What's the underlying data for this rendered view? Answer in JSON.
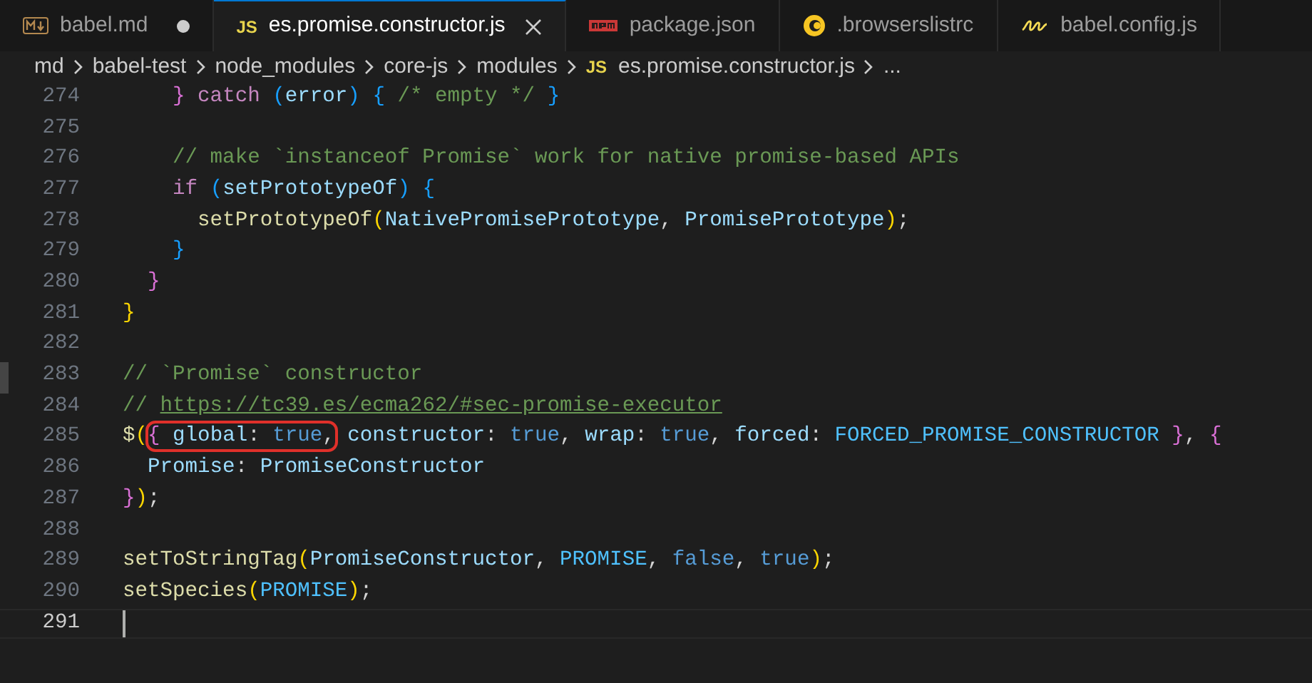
{
  "tabs": [
    {
      "label": "babel.md",
      "kind": "markdown",
      "dirty": true,
      "selected": false
    },
    {
      "label": "es.promise.constructor.js",
      "kind": "js",
      "icon_label": "JS",
      "dirty": false,
      "selected": true
    },
    {
      "label": "package.json",
      "kind": "npm",
      "dirty": false,
      "selected": false
    },
    {
      "label": ".browserslistrc",
      "kind": "browserslist",
      "dirty": false,
      "selected": false
    },
    {
      "label": "babel.config.js",
      "kind": "babel",
      "dirty": false,
      "selected": false
    }
  ],
  "breadcrumb": [
    {
      "label": "md"
    },
    {
      "label": "babel-test"
    },
    {
      "label": "node_modules"
    },
    {
      "label": "core-js"
    },
    {
      "label": "modules"
    },
    {
      "label": "es.promise.constructor.js",
      "icon_label": "JS"
    },
    {
      "label": "..."
    }
  ],
  "lines": [
    {
      "number": "274",
      "current": false,
      "tokens": [
        {
          "t": "    }",
          "kind": "b2"
        },
        {
          "t": " catch ",
          "kind": "kw"
        },
        {
          "t": "(",
          "kind": "b3"
        },
        {
          "t": "error",
          "kind": "var"
        },
        {
          "t": ")",
          "kind": "b3"
        },
        {
          "t": " {",
          "kind": "b3"
        },
        {
          "t": " /* empty */ ",
          "kind": "c"
        },
        {
          "t": "}",
          "kind": "b3"
        }
      ]
    },
    {
      "number": "275",
      "current": false
    },
    {
      "number": "276",
      "current": false,
      "tokens": [
        {
          "t": "    // make `instanceof Promise` work for native promise-based APIs",
          "kind": "c"
        }
      ]
    },
    {
      "number": "277",
      "current": false,
      "tokens": [
        {
          "t": "    if ",
          "kind": "kw"
        },
        {
          "t": "(",
          "kind": "b3"
        },
        {
          "t": "setPrototypeOf",
          "kind": "var"
        },
        {
          "t": ")",
          "kind": "b3"
        },
        {
          "t": " {",
          "kind": "b3"
        }
      ]
    },
    {
      "number": "278",
      "current": false,
      "tokens": [
        {
          "t": "      setPrototypeOf",
          "kind": "fn"
        },
        {
          "t": "(",
          "kind": "b1"
        },
        {
          "t": "NativePromisePrototype",
          "kind": "var"
        },
        {
          "t": ", ",
          "kind": "p"
        },
        {
          "t": "PromisePrototype",
          "kind": "var"
        },
        {
          "t": ")",
          "kind": "b1"
        },
        {
          "t": ";",
          "kind": "p"
        }
      ]
    },
    {
      "number": "279",
      "current": false,
      "tokens": [
        {
          "t": "    }",
          "kind": "b3"
        }
      ]
    },
    {
      "number": "280",
      "current": false,
      "tokens": [
        {
          "t": "  }",
          "kind": "b2"
        }
      ]
    },
    {
      "number": "281",
      "current": false,
      "tokens": [
        {
          "t": "}",
          "kind": "b1"
        }
      ]
    },
    {
      "number": "282",
      "current": false
    },
    {
      "number": "283",
      "current": false,
      "tokens": [
        {
          "t": "// `Promise` constructor",
          "kind": "c"
        }
      ]
    },
    {
      "number": "284",
      "current": false,
      "tokens": [
        {
          "t": "// ",
          "kind": "c"
        },
        {
          "t": "https://tc39.es/ecma262/#sec-promise-executor",
          "kind": "link"
        }
      ]
    },
    {
      "number": "285",
      "current": false,
      "tokens": [
        {
          "t": "$",
          "kind": "fn"
        },
        {
          "t": "(",
          "kind": "b1"
        },
        {
          "t": "{ ",
          "kind": "b2",
          "circled": true
        },
        {
          "t": "global",
          "kind": "var",
          "circled": true
        },
        {
          "t": ": ",
          "kind": "p",
          "circled": true
        },
        {
          "t": "true",
          "kind": "bool",
          "circled": true
        },
        {
          "t": ",",
          "kind": "p",
          "circled": true
        },
        {
          "t": " constructor",
          "kind": "var"
        },
        {
          "t": ": ",
          "kind": "p"
        },
        {
          "t": "true",
          "kind": "bool"
        },
        {
          "t": ", ",
          "kind": "p"
        },
        {
          "t": "wrap",
          "kind": "var"
        },
        {
          "t": ": ",
          "kind": "p"
        },
        {
          "t": "true",
          "kind": "bool"
        },
        {
          "t": ", ",
          "kind": "p"
        },
        {
          "t": "forced",
          "kind": "var"
        },
        {
          "t": ": ",
          "kind": "p"
        },
        {
          "t": "FORCED_PROMISE_CONSTRUCTOR",
          "kind": "const"
        },
        {
          "t": " }",
          "kind": "b2"
        },
        {
          "t": ", ",
          "kind": "p"
        },
        {
          "t": "{",
          "kind": "b2"
        }
      ]
    },
    {
      "number": "286",
      "current": false,
      "tokens": [
        {
          "t": "  Promise",
          "kind": "var"
        },
        {
          "t": ": ",
          "kind": "p"
        },
        {
          "t": "PromiseConstructor",
          "kind": "var"
        }
      ]
    },
    {
      "number": "287",
      "current": false,
      "tokens": [
        {
          "t": "}",
          "kind": "b2"
        },
        {
          "t": ")",
          "kind": "b1"
        },
        {
          "t": ";",
          "kind": "p"
        }
      ]
    },
    {
      "number": "288",
      "current": false
    },
    {
      "number": "289",
      "current": false,
      "tokens": [
        {
          "t": "setToStringTag",
          "kind": "fn"
        },
        {
          "t": "(",
          "kind": "b1"
        },
        {
          "t": "PromiseConstructor",
          "kind": "var"
        },
        {
          "t": ", ",
          "kind": "p"
        },
        {
          "t": "PROMISE",
          "kind": "const"
        },
        {
          "t": ", ",
          "kind": "p"
        },
        {
          "t": "false",
          "kind": "bool"
        },
        {
          "t": ", ",
          "kind": "p"
        },
        {
          "t": "true",
          "kind": "bool"
        },
        {
          "t": ")",
          "kind": "b1"
        },
        {
          "t": ";",
          "kind": "p"
        }
      ]
    },
    {
      "number": "290",
      "current": false,
      "tokens": [
        {
          "t": "setSpecies",
          "kind": "fn"
        },
        {
          "t": "(",
          "kind": "b1"
        },
        {
          "t": "PROMISE",
          "kind": "const"
        },
        {
          "t": ")",
          "kind": "b1"
        },
        {
          "t": ";",
          "kind": "p"
        }
      ]
    },
    {
      "number": "291",
      "current": true
    }
  ]
}
